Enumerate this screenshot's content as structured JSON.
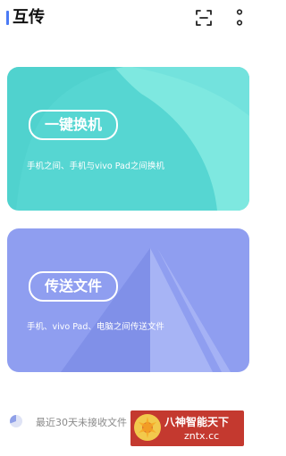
{
  "header": {
    "title": "互传",
    "accent_color": "#4b7bf5",
    "actions": [
      {
        "icon": "scan-icon"
      },
      {
        "icon": "more-vertical-icon"
      }
    ]
  },
  "cards": {
    "switch": {
      "button_label": "一键换机",
      "description": "手机之间、手机与vivo Pad之间换机",
      "color": "#56d6d2"
    },
    "transfer": {
      "button_label": "传送文件",
      "description": "手机、vivo Pad、电脑之间传送文件",
      "color": "#8f9ef0"
    }
  },
  "recent": {
    "text": "最近30天未接收文件",
    "icon": "pie-chart-icon"
  },
  "watermark": {
    "line1": "八神智能天下",
    "line2": "zntx.cc",
    "logo": "flower-logo",
    "color": "#c4392f"
  }
}
